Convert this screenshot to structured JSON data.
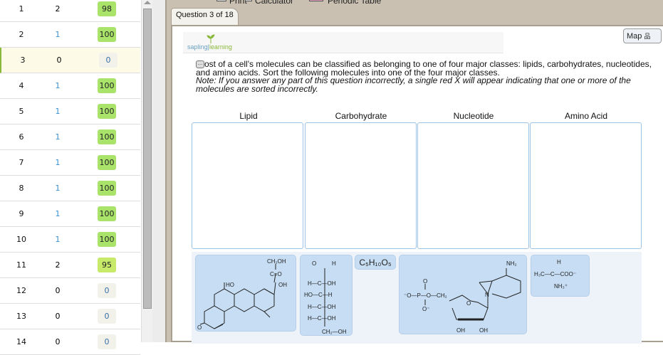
{
  "question_list": [
    {
      "num": "1",
      "attempts": "2",
      "score": "98",
      "state": "green"
    },
    {
      "num": "2",
      "attempts": "1",
      "score": "100",
      "state": "green"
    },
    {
      "num": "3",
      "attempts": "0",
      "score": "0",
      "state": "none",
      "active": true
    },
    {
      "num": "4",
      "attempts": "1",
      "score": "100",
      "state": "green"
    },
    {
      "num": "5",
      "attempts": "1",
      "score": "100",
      "state": "green"
    },
    {
      "num": "6",
      "attempts": "1",
      "score": "100",
      "state": "green"
    },
    {
      "num": "7",
      "attempts": "1",
      "score": "100",
      "state": "green"
    },
    {
      "num": "8",
      "attempts": "1",
      "score": "100",
      "state": "green"
    },
    {
      "num": "9",
      "attempts": "1",
      "score": "100",
      "state": "green"
    },
    {
      "num": "10",
      "attempts": "1",
      "score": "100",
      "state": "green"
    },
    {
      "num": "11",
      "attempts": "2",
      "score": "95",
      "state": "yellow"
    },
    {
      "num": "12",
      "attempts": "0",
      "score": "0",
      "state": "none"
    },
    {
      "num": "13",
      "attempts": "0",
      "score": "0",
      "state": "none"
    },
    {
      "num": "14",
      "attempts": "0",
      "score": "0",
      "state": "none"
    }
  ],
  "toolbar": {
    "print": "Print",
    "calculator": "Calculator",
    "periodic_table": "Periodic Table"
  },
  "tab": {
    "label": "Question 3 of 18"
  },
  "logo": {
    "part1": "sapling",
    "part2": "learning"
  },
  "map_button": "Map",
  "question": {
    "text": "ost of a cell's molecules can be classified as belonging to one of four major classes: lipids, carbohydrates, nucleotides, and amino acids. Sort the following molecules into one of the four major classes.",
    "note": "Note: If you answer any part of this question incorrectly, a single red X will appear indicating that one or more of the molecules are sorted incorrectly."
  },
  "categories": [
    "Lipid",
    "Carbohydrate",
    "Nucleotide",
    "Amino Acid"
  ],
  "molecules": {
    "steroid": {
      "ch2oh": "CH₂OH",
      "co": "C=O",
      "oh1": "OH",
      "ho": "HO",
      "o": "O"
    },
    "glucose": {
      "o": "O",
      "h": "H",
      "r1": "H—C—OH",
      "r2": "HO—C—H",
      "r3": "H—C—OH",
      "r4": "H—C—OH",
      "r5": "CH₂—OH"
    },
    "formula": "C₅H₁₀O₅",
    "nucleotide": {
      "nh2": "NH₂",
      "phosphate": "⁻O—P—O—CH₂",
      "o_top": "O",
      "o_bot": "O⁻",
      "oh1": "OH",
      "oh2": "OH",
      "n": "N",
      "ring_o": "O"
    },
    "amino": {
      "h": "H",
      "main": "H₃C—C—COO⁻",
      "nh3": "NH₃⁺"
    }
  },
  "colors": {
    "score_green": "#a9e36a",
    "score_yellow": "#c7ea6a",
    "card": "#c6ddf3",
    "panel": "#c9c0b1"
  }
}
